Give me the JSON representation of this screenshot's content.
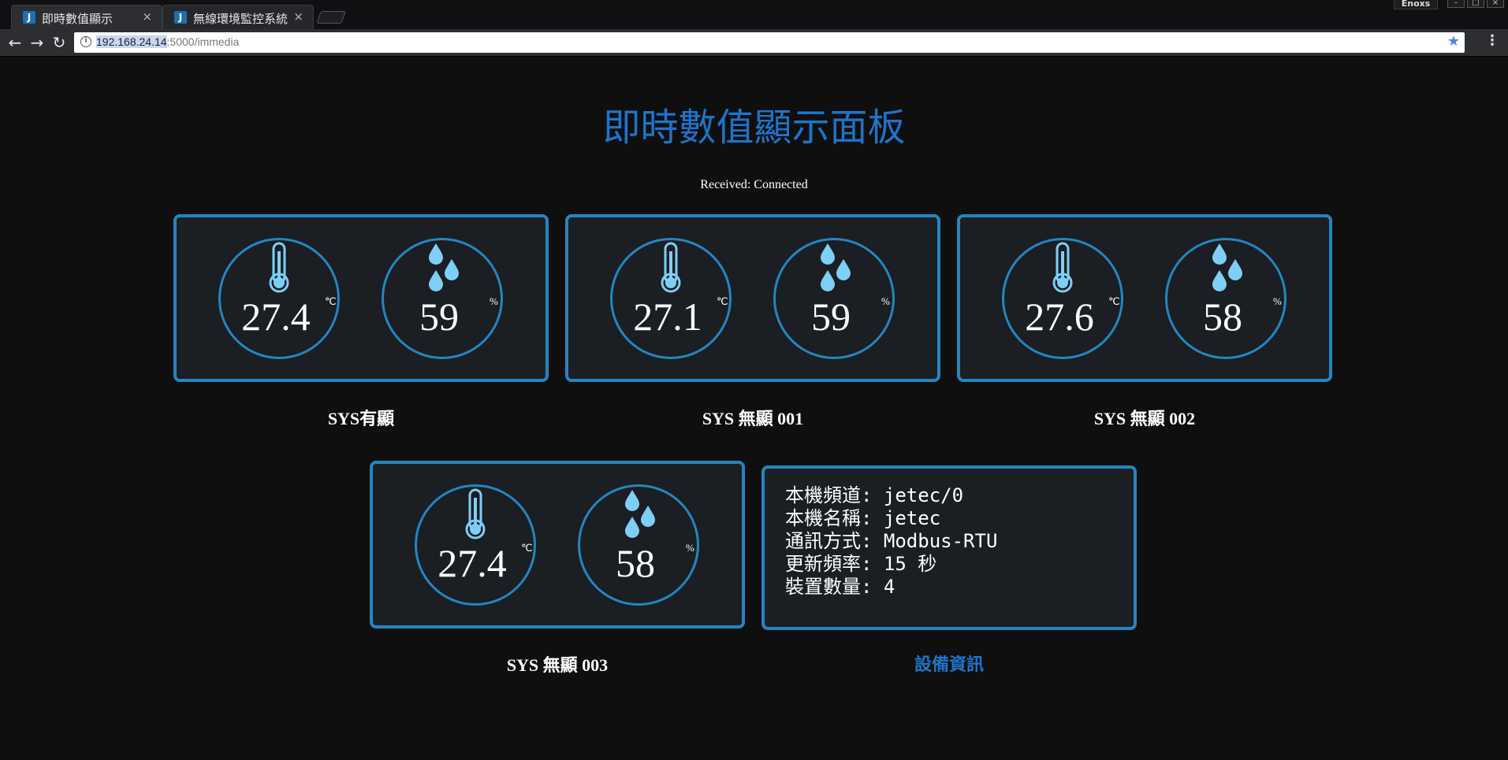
{
  "browser": {
    "tabs": [
      {
        "favicon": "J",
        "title": "即時數值顯示",
        "close": "×",
        "active": true
      },
      {
        "favicon": "J",
        "title": "無線環境監控系統",
        "close": "×",
        "active": false
      }
    ],
    "profile_label": "Enoxs",
    "url_host": "192.168.24.14",
    "url_rest": ":5000/immedia"
  },
  "page": {
    "title": "即時數值顯示面板",
    "status": "Received: Connected"
  },
  "devices": [
    {
      "name": "SYS有顯",
      "temperature": "27.4",
      "temperature_unit": "℃",
      "humidity": "59",
      "humidity_unit": "%"
    },
    {
      "name": "SYS 無顯 001",
      "temperature": "27.1",
      "temperature_unit": "℃",
      "humidity": "59",
      "humidity_unit": "%"
    },
    {
      "name": "SYS 無顯 002",
      "temperature": "27.6",
      "temperature_unit": "℃",
      "humidity": "58",
      "humidity_unit": "%"
    },
    {
      "name": "SYS 無顯 003",
      "temperature": "27.4",
      "temperature_unit": "℃",
      "humidity": "58",
      "humidity_unit": "%"
    }
  ],
  "device_info": {
    "title": "設備資訊",
    "lines": [
      "本機頻道: jetec/0",
      "本機名稱: jetec",
      "通訊方式: Modbus-RTU",
      "更新頻率: 15 秒",
      "裝置數量: 4"
    ]
  },
  "icons": {
    "temperature": "thermometer-icon",
    "humidity": "water-drops-icon"
  },
  "colors": {
    "accent": "#2386c1",
    "title": "#1e74c9",
    "icon": "#7ecff5",
    "background": "#0f0f10",
    "panel": "#1b1e22"
  }
}
